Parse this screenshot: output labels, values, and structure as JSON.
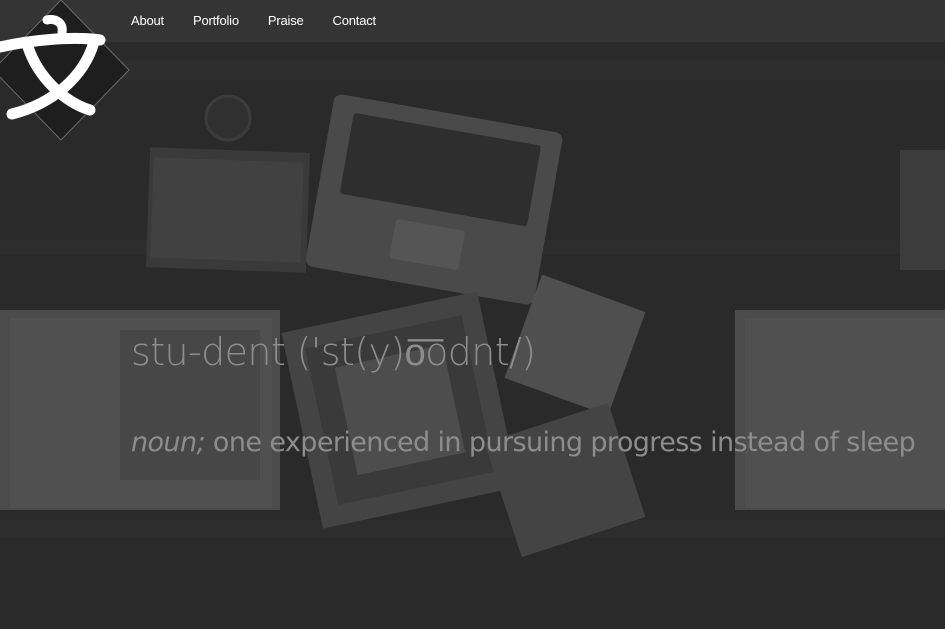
{
  "nav": {
    "items": [
      {
        "label": "About"
      },
      {
        "label": "Portfolio"
      },
      {
        "label": "Praise"
      },
      {
        "label": "Contact"
      }
    ]
  },
  "logo": {
    "icon": "diamond-glyph-logo",
    "glyph": "文"
  },
  "hero": {
    "headline": "stu-dent ('st(y)o͞odnt/)",
    "part_of_speech": "noun;",
    "definition": " one experienced in pursuing progress instead of sleep"
  },
  "colors": {
    "navbar": "#343434",
    "background": "#2a2a2a",
    "headline_text": "#8d8d8d",
    "nav_text": "#ffffff",
    "logo_fill": "#ffffff"
  }
}
